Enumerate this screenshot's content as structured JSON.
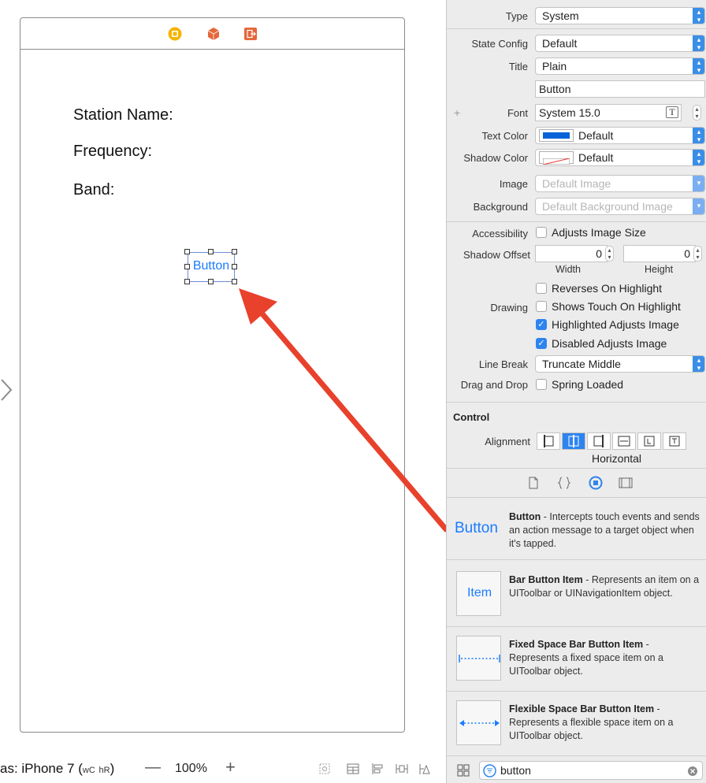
{
  "canvas": {
    "scene_labels": [
      "Station Name:",
      "Frequency:",
      "Band:"
    ],
    "selected_button_text": "Button",
    "bottom_bar": {
      "device_prefix": "as: iPhone 7 (",
      "wc": "wC",
      "hr": "hR",
      "device_suffix": ")",
      "zoom_out": "—",
      "zoom_level": "100%",
      "zoom_in": "+"
    }
  },
  "inspector": {
    "type_label": "Type",
    "type_value": "System",
    "state_config_label": "State Config",
    "state_config_value": "Default",
    "title_label": "Title",
    "title_value": "Plain",
    "title_text": "Button",
    "add_variation": "+",
    "font_label": "Font",
    "font_value": "System 15.0",
    "text_color_label": "Text Color",
    "text_color_value": "Default",
    "shadow_color_label": "Shadow Color",
    "shadow_color_value": "Default",
    "image_label": "Image",
    "image_placeholder": "Default Image",
    "background_label": "Background",
    "background_placeholder": "Default Background Image",
    "accessibility_label": "Accessibility",
    "adjusts_image_size": "Adjusts Image Size",
    "shadow_offset_label": "Shadow Offset",
    "shadow_width": "0",
    "shadow_height": "0",
    "width_caption": "Width",
    "height_caption": "Height",
    "drawing_label": "Drawing",
    "drawing_options": [
      {
        "label": "Reverses On Highlight",
        "checked": false
      },
      {
        "label": "Shows Touch On Highlight",
        "checked": false
      },
      {
        "label": "Highlighted Adjusts Image",
        "checked": true
      },
      {
        "label": "Disabled Adjusts Image",
        "checked": true
      }
    ],
    "line_break_label": "Line Break",
    "line_break_value": "Truncate Middle",
    "drag_drop_label": "Drag and Drop",
    "spring_loaded": "Spring Loaded",
    "control_header": "Control",
    "alignment_label": "Alignment",
    "horizontal_caption": "Horizontal"
  },
  "library": {
    "items": [
      {
        "thumb": "Button",
        "title": "Button",
        "desc": " - Intercepts touch events and sends an action message to a target object when it's tapped."
      },
      {
        "thumb": "Item",
        "title": "Bar Button Item",
        "desc": " - Represents an item on a UIToolbar or UINavigationItem object."
      },
      {
        "thumb": "",
        "title": "Fixed Space Bar Button Item",
        "desc": " - Represents a fixed space item on a UIToolbar object."
      },
      {
        "thumb": "",
        "title": "Flexible Space Bar Button Item",
        "desc": " - Represents a flexible space item on a UIToolbar object."
      }
    ],
    "filter_value": "button"
  },
  "colors": {
    "accent": "#2d84f0",
    "arrow": "#e8412c",
    "link_blue": "#1a7cff"
  }
}
